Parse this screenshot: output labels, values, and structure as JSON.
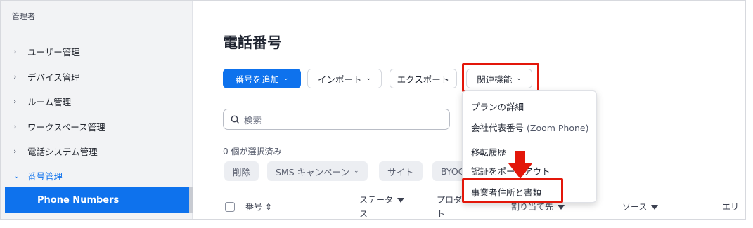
{
  "sidebar": {
    "header": "管理者",
    "items": [
      {
        "label": "ユーザー管理",
        "chevron": "›"
      },
      {
        "label": "デバイス管理",
        "chevron": "›"
      },
      {
        "label": "ルーム管理",
        "chevron": "›"
      },
      {
        "label": "ワークスペース管理",
        "chevron": "›"
      },
      {
        "label": "電話システム管理",
        "chevron": "›"
      },
      {
        "label": "番号管理",
        "chevron": "⌄"
      }
    ],
    "active_sub": "Phone Numbers"
  },
  "main": {
    "title": "電話番号",
    "toolbar": {
      "add": "番号を追加",
      "import": "インポート",
      "export": "エクスポート",
      "related": "関連機能",
      "caret": "⌄"
    },
    "search": {
      "placeholder": "検索"
    },
    "selected_count": "0 個が選択済み",
    "filters": {
      "delete": "削除",
      "sms": "SMS キャンペーン",
      "site": "サイト",
      "byoc": "BYOC"
    },
    "table": {
      "columns": [
        "番号",
        "ステータス",
        "プロダクト",
        "割り当て先",
        "ソース",
        "エリ"
      ],
      "status_line1": "ステータ",
      "status_line2": "ス",
      "product_line1": "プロダ",
      "product_line2": "ト",
      "sort_icon": "⇕"
    },
    "dropdown": {
      "items": [
        "プランの詳細",
        "会社代表番号",
        "移転履歴",
        "認証をポートアウト",
        "事業者住所と書類"
      ],
      "company_suffix": "(Zoom Phone)"
    }
  },
  "colors": {
    "accent": "#0e72ed",
    "highlight": "#e3170a",
    "sidebar_bg": "#f2f3f5"
  }
}
